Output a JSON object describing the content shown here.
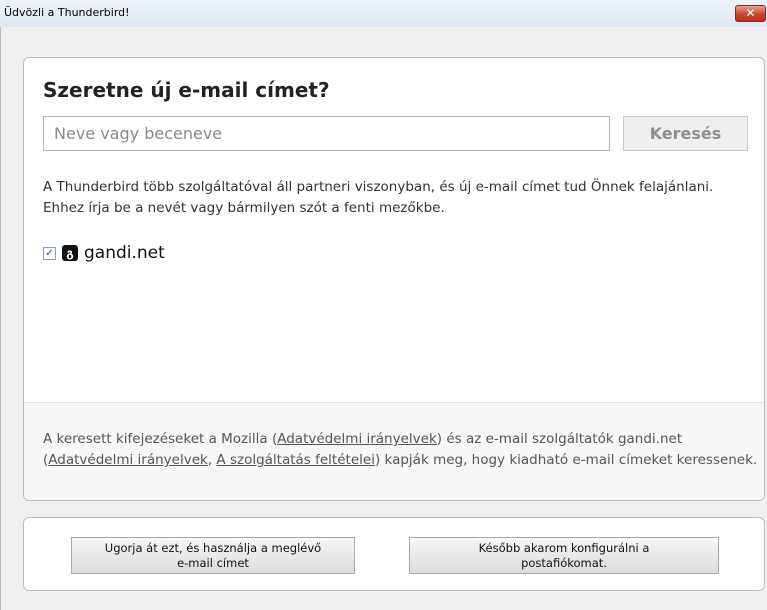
{
  "window": {
    "title": "Üdvözli a Thunderbird!",
    "close_symbol": "✕"
  },
  "main": {
    "heading": "Szeretne új e-mail címet?",
    "search": {
      "placeholder": "Neve vagy beceneve",
      "value": "",
      "button_label": "Keresés"
    },
    "description": "A Thunderbird több szolgáltatóval áll partneri viszonyban, és új e-mail címet tud Önnek felajánlani. Ehhez írja be a nevét vagy bármilyen szót a fenti mezőkbe.",
    "providers": [
      {
        "name": "gandi.net",
        "checked": true,
        "icon": "gandi-logo-icon"
      }
    ]
  },
  "privacy": {
    "text_1": "A keresett kifejezéseket a Mozilla (",
    "link_1": "Adatvédelmi irányelvek",
    "text_2": ") és az e-mail szolgáltatók gandi.net (",
    "link_2": "Adatvédelmi irányelvek",
    "text_3": ", ",
    "link_3": "A szolgáltatás feltételei",
    "text_4": ") kapják meg, hogy kiadható e-mail címeket keressenek."
  },
  "actions": {
    "skip_line1": "Ugorja át ezt, és használja a meglévő",
    "skip_line2": "e-mail címet",
    "later_line1": "Később akarom konfigurálni a",
    "later_line2": "postafiókomat."
  },
  "colors": {
    "close_button": "#c7472f",
    "card_border": "#bdbdbd",
    "footer_bg": "#f7f7f7"
  }
}
